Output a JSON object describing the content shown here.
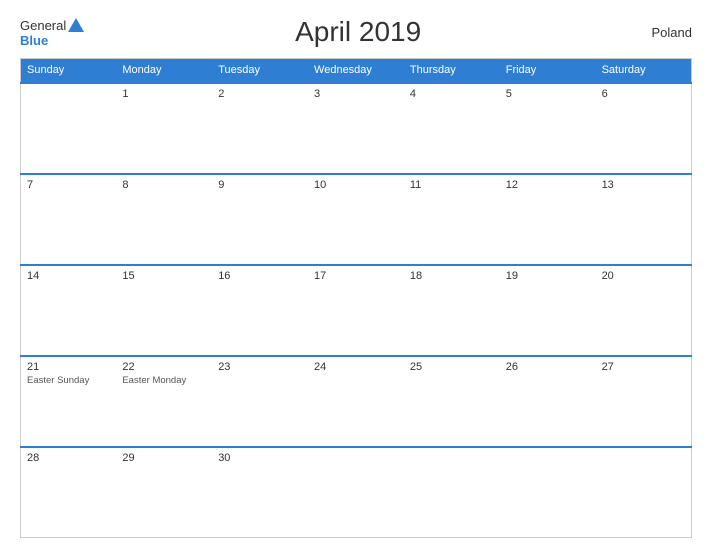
{
  "header": {
    "logo_general": "General",
    "logo_blue": "Blue",
    "title": "April 2019",
    "country": "Poland"
  },
  "weekdays": [
    "Sunday",
    "Monday",
    "Tuesday",
    "Wednesday",
    "Thursday",
    "Friday",
    "Saturday"
  ],
  "weeks": [
    [
      {
        "day": "",
        "holiday": ""
      },
      {
        "day": "1",
        "holiday": ""
      },
      {
        "day": "2",
        "holiday": ""
      },
      {
        "day": "3",
        "holiday": ""
      },
      {
        "day": "4",
        "holiday": ""
      },
      {
        "day": "5",
        "holiday": ""
      },
      {
        "day": "6",
        "holiday": ""
      }
    ],
    [
      {
        "day": "7",
        "holiday": ""
      },
      {
        "day": "8",
        "holiday": ""
      },
      {
        "day": "9",
        "holiday": ""
      },
      {
        "day": "10",
        "holiday": ""
      },
      {
        "day": "11",
        "holiday": ""
      },
      {
        "day": "12",
        "holiday": ""
      },
      {
        "day": "13",
        "holiday": ""
      }
    ],
    [
      {
        "day": "14",
        "holiday": ""
      },
      {
        "day": "15",
        "holiday": ""
      },
      {
        "day": "16",
        "holiday": ""
      },
      {
        "day": "17",
        "holiday": ""
      },
      {
        "day": "18",
        "holiday": ""
      },
      {
        "day": "19",
        "holiday": ""
      },
      {
        "day": "20",
        "holiday": ""
      }
    ],
    [
      {
        "day": "21",
        "holiday": "Easter Sunday"
      },
      {
        "day": "22",
        "holiday": "Easter Monday"
      },
      {
        "day": "23",
        "holiday": ""
      },
      {
        "day": "24",
        "holiday": ""
      },
      {
        "day": "25",
        "holiday": ""
      },
      {
        "day": "26",
        "holiday": ""
      },
      {
        "day": "27",
        "holiday": ""
      }
    ],
    [
      {
        "day": "28",
        "holiday": ""
      },
      {
        "day": "29",
        "holiday": ""
      },
      {
        "day": "30",
        "holiday": ""
      },
      {
        "day": "",
        "holiday": ""
      },
      {
        "day": "",
        "holiday": ""
      },
      {
        "day": "",
        "holiday": ""
      },
      {
        "day": "",
        "holiday": ""
      }
    ]
  ]
}
